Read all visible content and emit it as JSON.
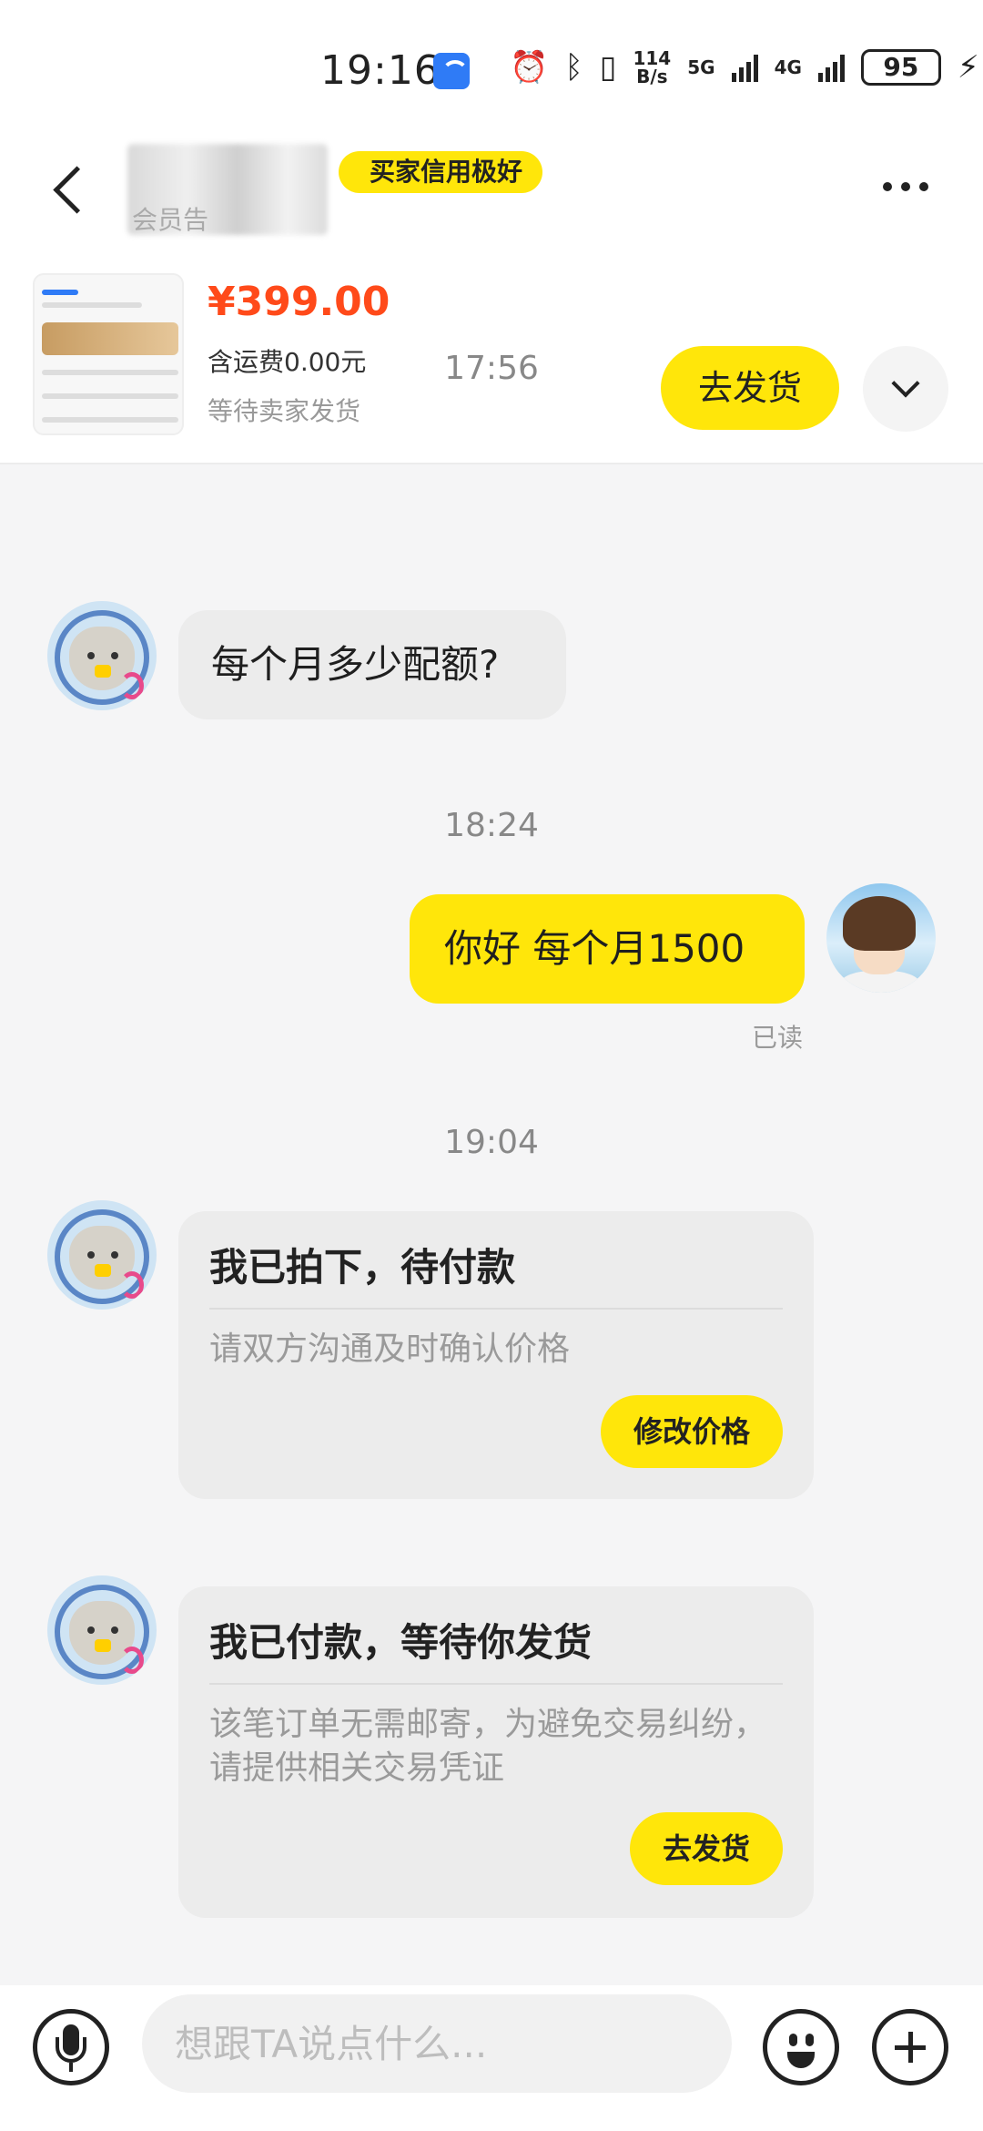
{
  "status_bar": {
    "time": "19:16",
    "net_speed_top": "114",
    "net_speed_bottom": "B/s",
    "signal_1": "5G",
    "signal_2": "4G",
    "battery": "95"
  },
  "header": {
    "badge": "买家信用极好",
    "subtitle": "会员告"
  },
  "product": {
    "price": "¥399.00",
    "shipping_fee": "含运费0.00元",
    "status": "等待卖家发货",
    "ship_button": "去发货"
  },
  "messages": {
    "time_1": "17:56",
    "msg_1": "每个月多少配额?",
    "time_2": "18:24",
    "msg_2": "你好 每个月1500",
    "read_label": "已读",
    "time_3": "19:04"
  },
  "card_1": {
    "title": "我已拍下，待付款",
    "desc": "请双方沟通及时确认价格",
    "button": "修改价格"
  },
  "card_2": {
    "title": "我已付款，等待你发货",
    "desc": "该笔订单无需邮寄，为避免交易纠纷，请提供相关交易凭证",
    "button": "去发货"
  },
  "input": {
    "placeholder": "想跟TA说点什么..."
  },
  "icons": {
    "back": "back-arrow-icon",
    "more": "more-dots-icon",
    "expand": "chevron-down-icon",
    "mic": "microphone-icon",
    "emoji": "emoji-icon",
    "plus": "plus-icon"
  },
  "colors": {
    "accent_yellow": "#ffe60a",
    "price_red": "#ff4a1a",
    "bubble_gray": "#ececec"
  }
}
